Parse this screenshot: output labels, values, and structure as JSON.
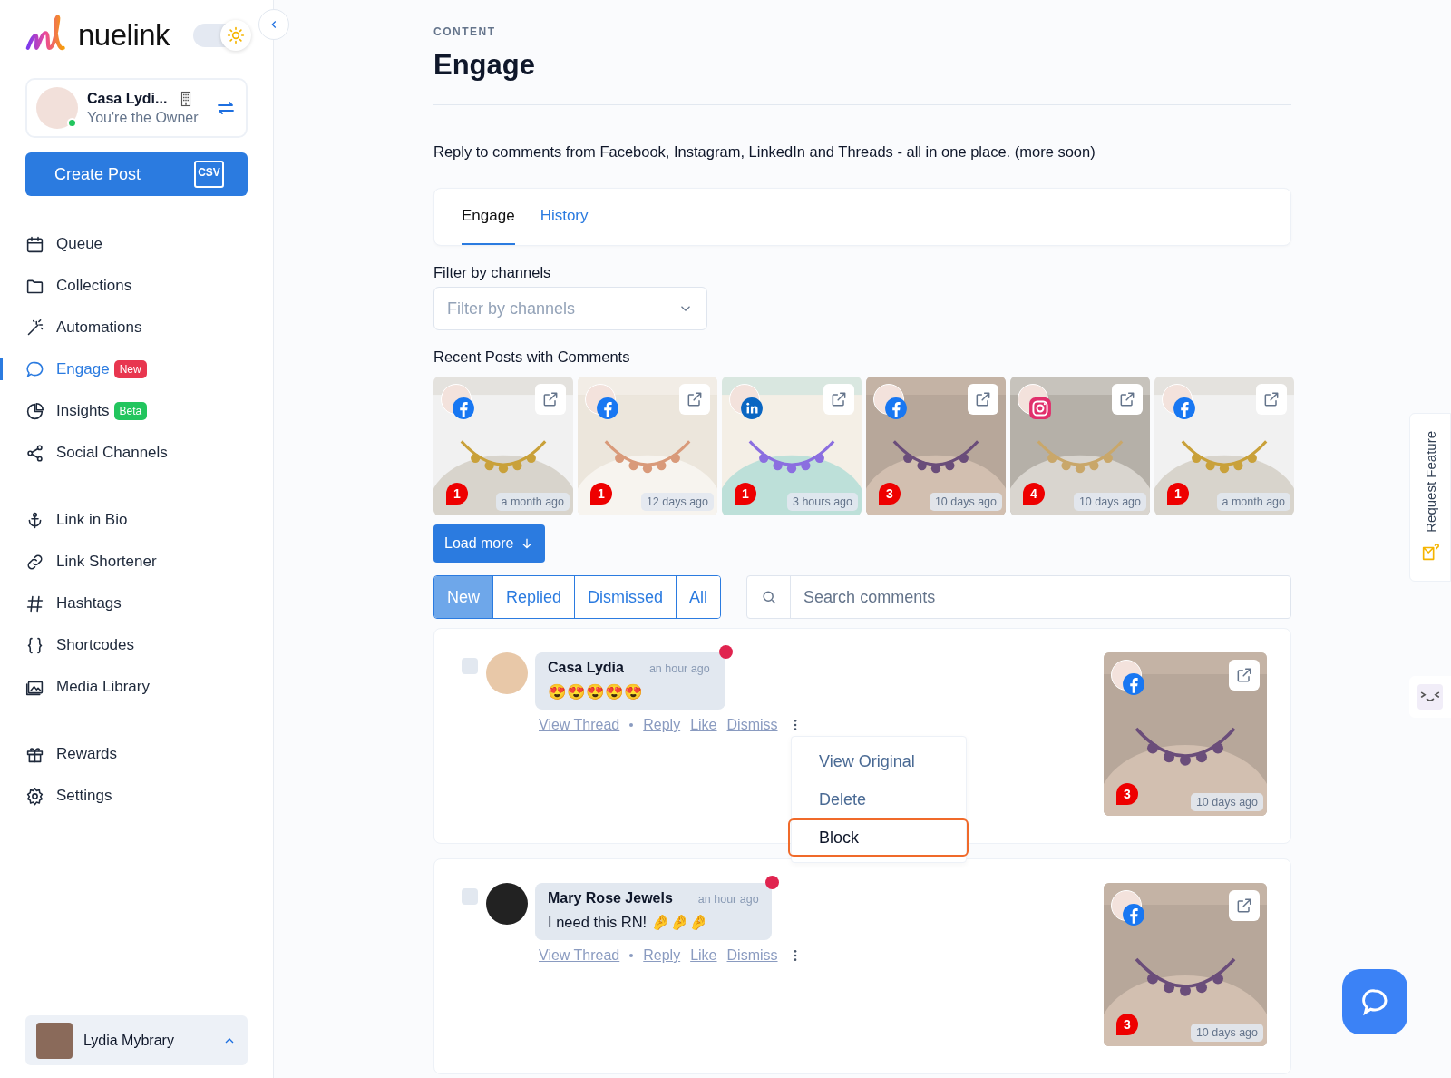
{
  "brand": {
    "name": "nuelink"
  },
  "workspace": {
    "name": "Casa Lydi...",
    "role": "You're the Owner",
    "online": true
  },
  "create_post": {
    "label": "Create Post",
    "csv_label": "CSV"
  },
  "theme_toggle": {
    "on": true
  },
  "nav_groups": [
    {
      "items": [
        {
          "label": "Queue",
          "selected": false
        },
        {
          "label": "Collections",
          "selected": false
        },
        {
          "label": "Automations",
          "selected": false
        },
        {
          "label": "Engage",
          "selected": true,
          "badge": "New",
          "color": "#e8364f"
        },
        {
          "label": "Insights",
          "selected": false,
          "badge": "Beta",
          "color": "#22c55e"
        },
        {
          "label": "Social Channels",
          "selected": false
        }
      ]
    },
    {
      "items": [
        {
          "label": "Link in Bio",
          "selected": false
        },
        {
          "label": "Link Shortener",
          "selected": false
        },
        {
          "label": "Hashtags",
          "selected": false
        },
        {
          "label": "Shortcodes",
          "selected": false
        },
        {
          "label": "Media Library",
          "selected": false
        }
      ]
    },
    {
      "items": [
        {
          "label": "Rewards",
          "selected": false
        },
        {
          "label": "Settings",
          "selected": false
        }
      ]
    }
  ],
  "user": {
    "name": "Lydia Mybrary"
  },
  "header": {
    "section": "CONTENT",
    "title": "Engage",
    "description": "Reply to comments from Facebook, Instagram, LinkedIn and Threads - all in one place. (more soon)"
  },
  "tabs": [
    {
      "label": "Engage",
      "selected": true
    },
    {
      "label": "History",
      "selected": false
    }
  ],
  "filter": {
    "label": "Filter by channels",
    "placeholder": "Filter by channels"
  },
  "recent": {
    "label": "Recent Posts with Comments",
    "load_more": "Load more",
    "posts": [
      {
        "kind": "facebook",
        "count": "1",
        "time": "a month ago"
      },
      {
        "kind": "facebook",
        "count": "1",
        "time": "12 days ago"
      },
      {
        "kind": "linkedin",
        "count": "1",
        "time": "3 hours ago"
      },
      {
        "kind": "facebook",
        "count": "3",
        "time": "10 days ago"
      },
      {
        "kind": "instagram",
        "count": "4",
        "time": "10 days ago"
      },
      {
        "kind": "facebook",
        "count": "1",
        "time": "a month ago"
      }
    ]
  },
  "status_tabs": [
    {
      "label": "New",
      "selected": true
    },
    {
      "label": "Replied",
      "selected": false
    },
    {
      "label": "Dismissed",
      "selected": false
    },
    {
      "label": "All",
      "selected": false
    }
  ],
  "search": {
    "placeholder": "Search comments"
  },
  "comments": [
    {
      "author": "Casa Lydia",
      "time": "an hour ago",
      "text": "😍😍😍😍😍",
      "unread": true,
      "checked": false,
      "actions": [
        "View Thread",
        "Reply",
        "Like",
        "Dismiss"
      ],
      "post": {
        "kind": "facebook",
        "count": "3",
        "time": "10 days ago"
      },
      "menu": [
        {
          "label": "View Original",
          "selected": false
        },
        {
          "label": "Delete",
          "selected": false
        },
        {
          "label": "Block",
          "selected": true
        }
      ]
    },
    {
      "author": "Mary Rose Jewels",
      "time": "an hour ago",
      "text": "I need this RN! 🤌🤌🤌",
      "unread": true,
      "checked": false,
      "actions": [
        "View Thread",
        "Reply",
        "Like",
        "Dismiss"
      ],
      "post": {
        "kind": "facebook",
        "count": "3",
        "time": "10 days ago"
      }
    }
  ],
  "request_feature": {
    "label": "Request Feature"
  }
}
